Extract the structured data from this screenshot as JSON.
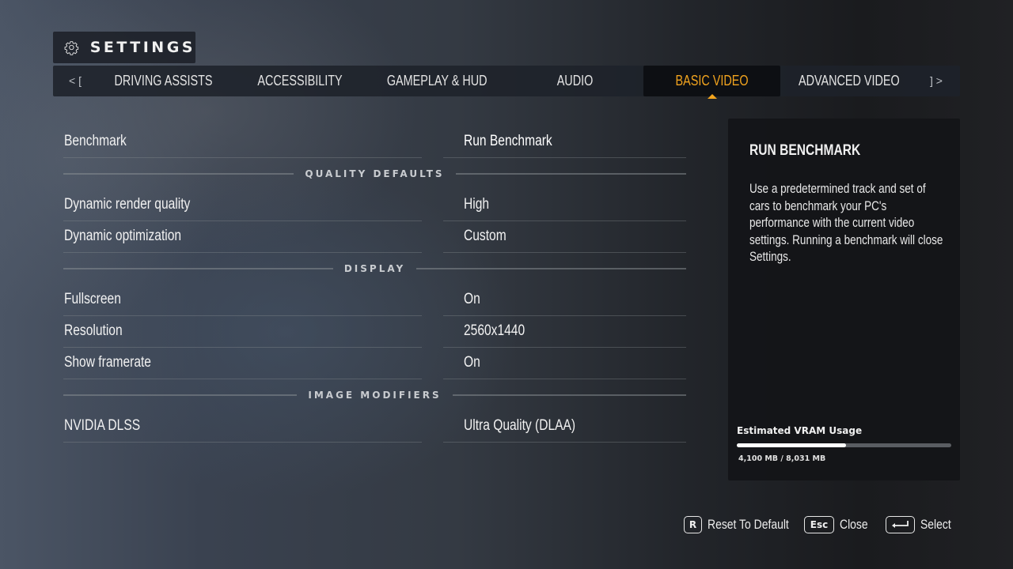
{
  "header": {
    "title": "SETTINGS",
    "icon": "gear-icon"
  },
  "tabs": {
    "prev_hint": "< [",
    "next_hint": "] >",
    "items": [
      {
        "label": "DRIVING ASSISTS",
        "active": false
      },
      {
        "label": "ACCESSIBILITY",
        "active": false
      },
      {
        "label": "GAMEPLAY & HUD",
        "active": false
      },
      {
        "label": "AUDIO",
        "active": false
      },
      {
        "label": "BASIC VIDEO",
        "active": true
      },
      {
        "label": "ADVANCED VIDEO",
        "active": false
      }
    ]
  },
  "settings": {
    "benchmark": {
      "label": "Benchmark",
      "value": "Run Benchmark"
    },
    "sections": {
      "quality_defaults": "QUALITY DEFAULTS",
      "display": "DISPLAY",
      "image_modifiers": "IMAGE MODIFIERS"
    },
    "dynamic_render_quality": {
      "label": "Dynamic render quality",
      "value": "High"
    },
    "dynamic_optimization": {
      "label": "Dynamic optimization",
      "value": "Custom"
    },
    "fullscreen": {
      "label": "Fullscreen",
      "value": "On"
    },
    "resolution": {
      "label": "Resolution",
      "value": "2560x1440"
    },
    "show_framerate": {
      "label": "Show framerate",
      "value": "On"
    },
    "nvidia_dlss": {
      "label": "NVIDIA DLSS",
      "value": "Ultra Quality (DLAA)"
    }
  },
  "info_panel": {
    "title": "RUN BENCHMARK",
    "description": "Use a predetermined track and set of cars to benchmark your PC's performance with the current video settings. Running a benchmark will close Settings.",
    "vram": {
      "label": "Estimated VRAM Usage",
      "used_mb": 4100,
      "total_mb": 8031,
      "text": "4,100 MB / 8,031 MB"
    }
  },
  "footer": {
    "reset": {
      "key": "R",
      "label": "Reset To Default"
    },
    "close": {
      "key": "Esc",
      "label": "Close"
    },
    "select": {
      "key": "enter-icon",
      "label": "Select"
    }
  },
  "colors": {
    "accent": "#f2a41e",
    "panel": "#141518"
  }
}
